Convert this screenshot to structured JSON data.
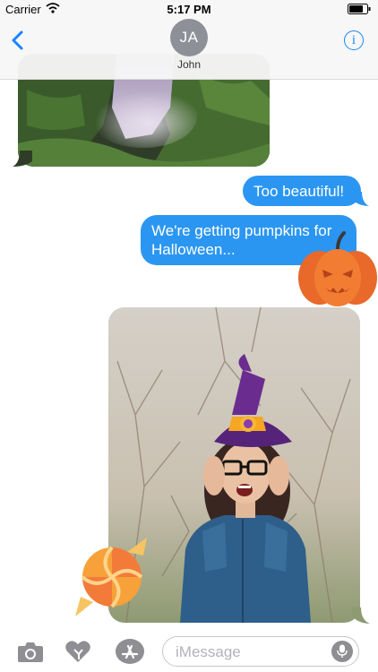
{
  "status_bar": {
    "carrier": "Carrier",
    "time": "5:17 PM"
  },
  "header": {
    "avatar_initials": "JA",
    "contact_name": "John",
    "info_label": "i"
  },
  "messages": [
    {
      "type": "image",
      "direction": "incoming",
      "subject": "waterfall-photo"
    },
    {
      "type": "text",
      "direction": "outgoing",
      "text": "Too beautiful!"
    },
    {
      "type": "text",
      "direction": "outgoing",
      "text": "We're getting pumpkins for Halloween..."
    },
    {
      "type": "image",
      "direction": "outgoing",
      "subject": "woman-with-witch-hat-photo"
    }
  ],
  "stickers": [
    "pumpkin-sticker",
    "witch-hat-sticker",
    "candy-sticker"
  ],
  "input_bar": {
    "placeholder": "iMessage"
  },
  "colors": {
    "accent": "#1a84ff",
    "outgoing_bubble": "#2b96f1",
    "avatar": "#8e9097",
    "pumpkin": "#f0782a",
    "witch_hat": "#6b2c8f",
    "hat_band": "#f5a623"
  }
}
